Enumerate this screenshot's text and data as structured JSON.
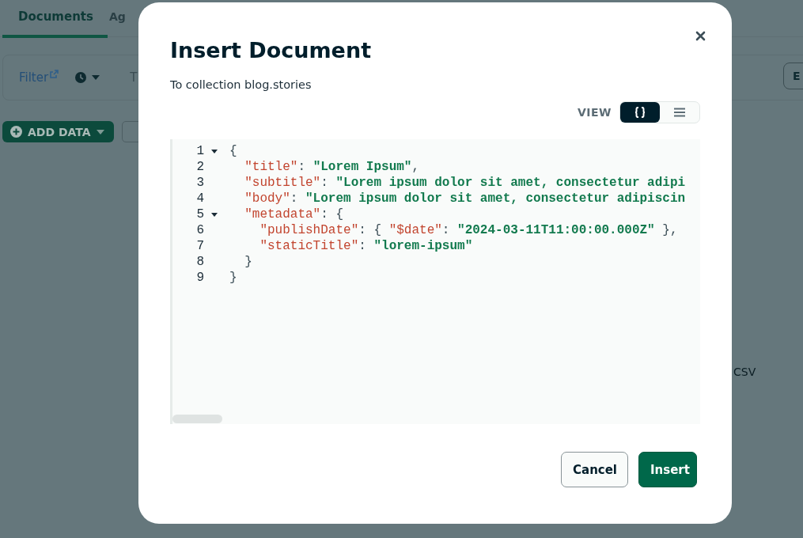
{
  "page": {
    "tabs": [
      {
        "label": "Documents",
        "selected": true
      },
      {
        "label": "Ag",
        "selected": false
      }
    ],
    "filter_link": "Filter",
    "query_hint": "T",
    "add_data_button": "ADD DATA",
    "right_button": "E",
    "side_text": "CSV"
  },
  "modal": {
    "title": "Insert Document",
    "subtitle": "To collection blog.stories",
    "view_label": "VIEW",
    "view_options": [
      {
        "kind": "json",
        "selected": true
      },
      {
        "kind": "list",
        "selected": false
      }
    ],
    "editor": {
      "lines": [
        {
          "number": "1",
          "foldable": true,
          "tokens": [
            {
              "kind": "punct",
              "text": "{"
            }
          ]
        },
        {
          "number": "2",
          "foldable": false,
          "tokens": [
            {
              "kind": "key",
              "text": "  \"title\""
            },
            {
              "kind": "punct",
              "text": ": "
            },
            {
              "kind": "string",
              "text": "\"Lorem Ipsum\""
            },
            {
              "kind": "punct",
              "text": ","
            }
          ]
        },
        {
          "number": "3",
          "foldable": false,
          "tokens": [
            {
              "kind": "key",
              "text": "  \"subtitle\""
            },
            {
              "kind": "punct",
              "text": ": "
            },
            {
              "kind": "string",
              "text": "\"Lorem ipsum dolor sit amet, consectetur adipi"
            }
          ]
        },
        {
          "number": "4",
          "foldable": false,
          "tokens": [
            {
              "kind": "key",
              "text": "  \"body\""
            },
            {
              "kind": "punct",
              "text": ": "
            },
            {
              "kind": "string",
              "text": "\"Lorem ipsum dolor sit amet, consectetur adipiscin"
            }
          ]
        },
        {
          "number": "5",
          "foldable": true,
          "tokens": [
            {
              "kind": "key",
              "text": "  \"metadata\""
            },
            {
              "kind": "punct",
              "text": ": {"
            }
          ]
        },
        {
          "number": "6",
          "foldable": false,
          "tokens": [
            {
              "kind": "key",
              "text": "    \"publishDate\""
            },
            {
              "kind": "punct",
              "text": ": { "
            },
            {
              "kind": "key",
              "text": "\"$date\""
            },
            {
              "kind": "punct",
              "text": ": "
            },
            {
              "kind": "string",
              "text": "\"2024-03-11T11:00:00.000Z\""
            },
            {
              "kind": "punct",
              "text": " },"
            }
          ]
        },
        {
          "number": "7",
          "foldable": false,
          "tokens": [
            {
              "kind": "key",
              "text": "    \"staticTitle\""
            },
            {
              "kind": "punct",
              "text": ": "
            },
            {
              "kind": "string",
              "text": "\"lorem-ipsum\""
            }
          ]
        },
        {
          "number": "8",
          "foldable": false,
          "tokens": [
            {
              "kind": "punct",
              "text": "  }"
            }
          ]
        },
        {
          "number": "9",
          "foldable": false,
          "tokens": [
            {
              "kind": "punct",
              "text": "}"
            }
          ]
        }
      ]
    },
    "buttons": [
      {
        "kind": "secondary",
        "label": "Cancel"
      },
      {
        "kind": "primary",
        "label": "Insert"
      }
    ]
  }
}
